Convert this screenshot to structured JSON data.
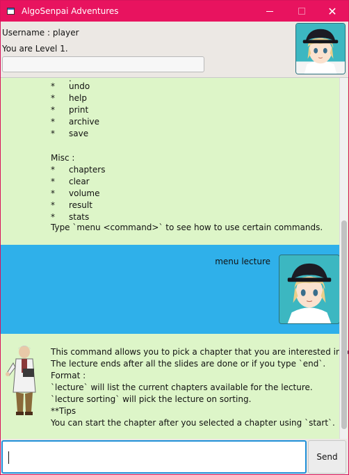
{
  "window": {
    "title": "AlgoSenpai Adventures",
    "minimize_glyph": "—",
    "close_glyph": "✕"
  },
  "header": {
    "username_label": "Username : player",
    "level_label": "You are Level 1.",
    "progress": 0.0
  },
  "dialog": {
    "command_list": [
      {
        "bullet": "*",
        "label": "undo"
      },
      {
        "bullet": "*",
        "label": "help"
      },
      {
        "bullet": "*",
        "label": "print"
      },
      {
        "bullet": "*",
        "label": "archive"
      },
      {
        "bullet": "*",
        "label": "save"
      }
    ],
    "misc_heading": "Misc :",
    "misc_list": [
      {
        "bullet": "*",
        "label": "chapters"
      },
      {
        "bullet": "*",
        "label": "clear"
      },
      {
        "bullet": "*",
        "label": "volume"
      },
      {
        "bullet": "*",
        "label": "result"
      },
      {
        "bullet": "*",
        "label": "stats"
      }
    ],
    "hint": "Type `menu <command>` to see how to use certain commands.",
    "user_message": "menu lecture",
    "bot_response": [
      "This command allows you to pick a chapter that you are interested in revising.",
      "The lecture ends after all the slides are done or if you type `end`.",
      "Format :",
      "`lecture` will list the current chapters available for the lecture.",
      "`lecture sorting` will pick the lecture on sorting.",
      "**Tips",
      "You can start the chapter after you selected a chapter using `start`."
    ]
  },
  "input": {
    "value": "",
    "send_label": "Send"
  },
  "colors": {
    "titlebar": "#e8135f",
    "dialog_bg": "#ddf5c8",
    "user_row_bg": "#2fb0ea",
    "input_focus": "#1f8fd8"
  }
}
